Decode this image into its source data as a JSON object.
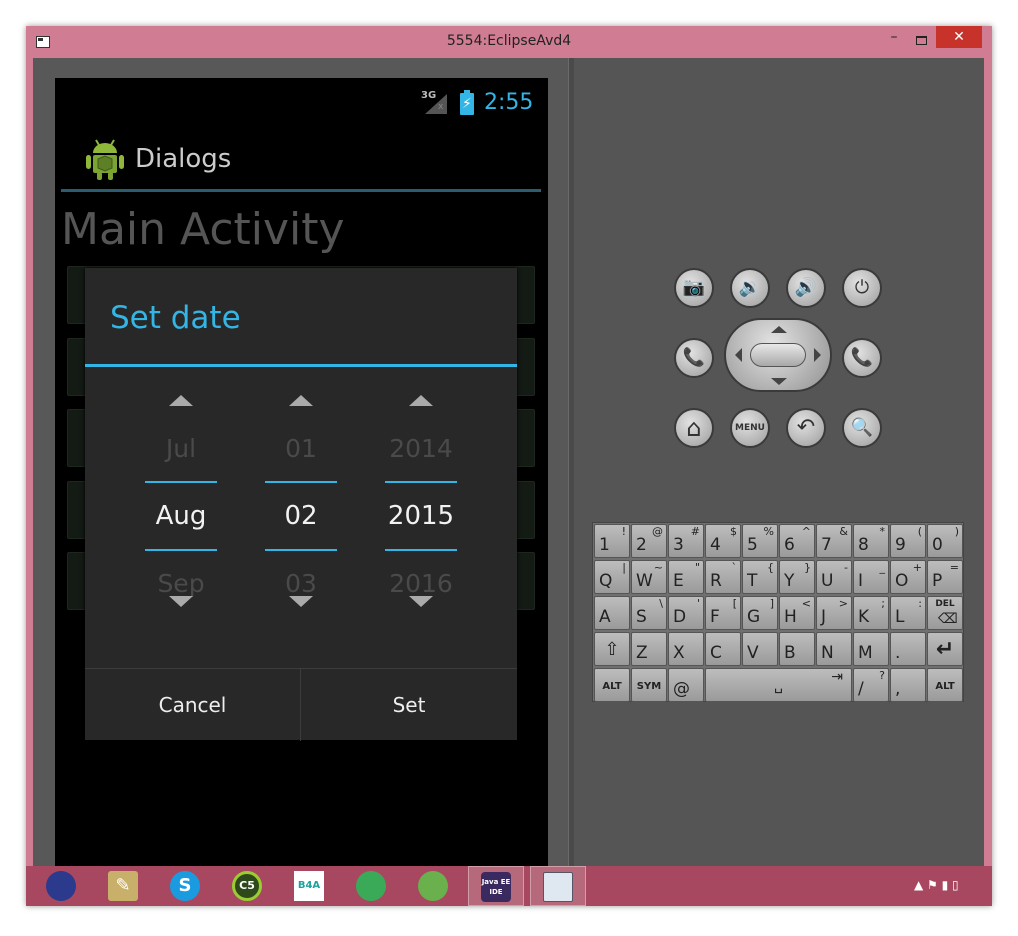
{
  "window": {
    "title": "5554:EclipseAvd4",
    "minimize_glyph": "–",
    "close_glyph": "✕"
  },
  "status_bar": {
    "network": "3G",
    "network_sub": "x",
    "time": "2:55",
    "battery_glyph": "⚡"
  },
  "action_bar": {
    "title": "Dialogs"
  },
  "main": {
    "title": "Main Activity"
  },
  "dialog": {
    "title": "Set date",
    "columns": [
      {
        "name": "month",
        "prev": "Jul",
        "current": "Aug",
        "next": "Sep"
      },
      {
        "name": "day",
        "prev": "01",
        "current": "02",
        "next": "03"
      },
      {
        "name": "year",
        "prev": "2014",
        "current": "2015",
        "next": "2016"
      }
    ],
    "cancel_label": "Cancel",
    "set_label": "Set"
  },
  "hw_buttons": {
    "camera": "📷",
    "vol_down": "🔉",
    "vol_up": "🔊",
    "power": "⏻",
    "call": "📞",
    "end_call": "📞",
    "home": "⌂",
    "menu": "MENU",
    "back": "↶",
    "search": "🔍"
  },
  "keyboard": {
    "row1": [
      [
        "1",
        "!"
      ],
      [
        "2",
        "@"
      ],
      [
        "3",
        "#"
      ],
      [
        "4",
        "$"
      ],
      [
        "5",
        "%"
      ],
      [
        "6",
        "^"
      ],
      [
        "7",
        "&"
      ],
      [
        "8",
        "*"
      ],
      [
        "9",
        "("
      ],
      [
        "0",
        ")"
      ]
    ],
    "row2": [
      [
        "Q",
        "|"
      ],
      [
        "W",
        "~"
      ],
      [
        "E",
        "\""
      ],
      [
        "R",
        "`"
      ],
      [
        "T",
        "{"
      ],
      [
        "Y",
        "}"
      ],
      [
        "U",
        "-"
      ],
      [
        "I",
        "_"
      ],
      [
        "O",
        "+"
      ],
      [
        "P",
        "="
      ]
    ],
    "row3": [
      [
        "A",
        ""
      ],
      [
        "S",
        "\\"
      ],
      [
        "D",
        "'"
      ],
      [
        "F",
        "["
      ],
      [
        "G",
        "]"
      ],
      [
        "H",
        "<"
      ],
      [
        "J",
        ">"
      ],
      [
        "K",
        ";"
      ],
      [
        "L",
        ":"
      ],
      [
        "DEL",
        "⌫"
      ]
    ],
    "row4": [
      "⇧",
      "Z",
      "X",
      "C",
      "V",
      "B",
      "N",
      "M",
      ".",
      "↵"
    ],
    "row5": {
      "alt_left": "ALT",
      "sym": "SYM",
      "at": "@",
      "space": "␣",
      "tab": "⇥",
      "slash": "/",
      "question": "?",
      "comma": ",",
      "alt_right": "ALT"
    }
  },
  "taskbar": {
    "items": [
      {
        "name": "eclipse",
        "label": "",
        "color": "#2b3a8c"
      },
      {
        "name": "notepad",
        "label": "✎",
        "color": "#c9b06a"
      },
      {
        "name": "skype",
        "label": "S",
        "color": "#1a9be0"
      },
      {
        "name": "cs5",
        "label": "C5",
        "color": "#2f4a1a"
      },
      {
        "name": "b4a",
        "label": "B4A",
        "color": "#ffffff"
      },
      {
        "name": "ninja",
        "label": "",
        "color": "#3aaa58"
      },
      {
        "name": "android-studio",
        "label": "",
        "color": "#6ab04c"
      },
      {
        "name": "java-ee",
        "label": "Java EE IDE",
        "color": "#3a2a60"
      },
      {
        "name": "emulator",
        "label": "",
        "color": "#dfe8f0"
      }
    ],
    "tray": "▲ ⚑ ▮ ▯"
  }
}
